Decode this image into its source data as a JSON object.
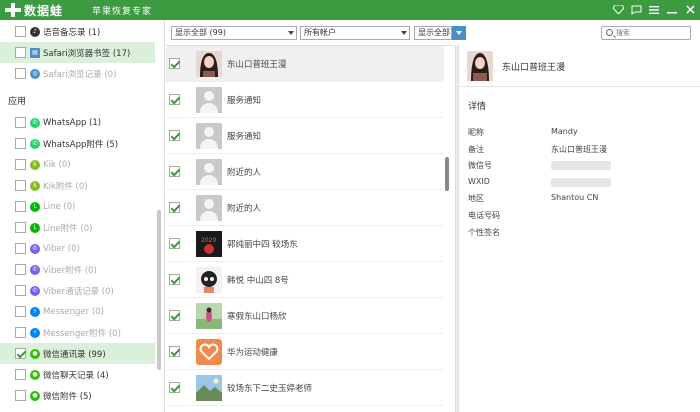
{
  "titlebar": {
    "title": "数据蛙",
    "subtitle": "苹果恢复专家",
    "icons": [
      "diamond-icon",
      "chat-icon",
      "menu-icon",
      "minimize-icon",
      "close-icon"
    ]
  },
  "sidebar": {
    "top_items": [
      {
        "label": "语音备忘录 (1)",
        "icon": "voice-memo-icon",
        "color": "#333333",
        "checked": false,
        "dim": false
      },
      {
        "label": "Safari浏览器书签 (17)",
        "icon": "book-icon",
        "color": "#4a90c8",
        "checked": false,
        "dim": false,
        "selected": true
      },
      {
        "label": "Safari浏览记录 (0)",
        "icon": "safari-icon",
        "color": "#4a90c8",
        "checked": false,
        "dim": true
      }
    ],
    "section_title": "应用",
    "app_items": [
      {
        "label": "WhatsApp (1)",
        "icon": "whatsapp-icon",
        "color": "#25d366",
        "checked": false,
        "dim": false
      },
      {
        "label": "WhatsApp附件 (5)",
        "icon": "whatsapp-icon",
        "color": "#25d366",
        "checked": false,
        "dim": false
      },
      {
        "label": "Kik (0)",
        "icon": "kik-icon",
        "color": "#82bc23",
        "checked": false,
        "dim": true
      },
      {
        "label": "Kik附件 (0)",
        "icon": "kik-icon",
        "color": "#82bc23",
        "checked": false,
        "dim": true
      },
      {
        "label": "Line (0)",
        "icon": "line-icon",
        "color": "#00b900",
        "checked": false,
        "dim": true
      },
      {
        "label": "Line附件 (0)",
        "icon": "line-icon",
        "color": "#00b900",
        "checked": false,
        "dim": true
      },
      {
        "label": "Viber (0)",
        "icon": "viber-icon",
        "color": "#7360f2",
        "checked": false,
        "dim": true
      },
      {
        "label": "Viber附件 (0)",
        "icon": "viber-icon",
        "color": "#7360f2",
        "checked": false,
        "dim": true
      },
      {
        "label": "Viber通话记录 (0)",
        "icon": "viber-icon",
        "color": "#7360f2",
        "checked": false,
        "dim": true
      },
      {
        "label": "Messenger (0)",
        "icon": "messenger-icon",
        "color": "#0084ff",
        "checked": false,
        "dim": true
      },
      {
        "label": "Messenger附件 (0)",
        "icon": "messenger-icon",
        "color": "#0084ff",
        "checked": false,
        "dim": true
      },
      {
        "label": "微信通讯录 (99)",
        "icon": "wechat-icon",
        "color": "#2dc100",
        "checked": true,
        "dim": false,
        "selected": true
      },
      {
        "label": "微信聊天记录 (4)",
        "icon": "wechat-icon",
        "color": "#2dc100",
        "checked": false,
        "dim": false
      },
      {
        "label": "微信附件 (5)",
        "icon": "wechat-icon",
        "color": "#2dc100",
        "checked": false,
        "dim": false
      }
    ]
  },
  "filter": {
    "show_all_select": "显示全部 (99)",
    "account_select": "所有帐户",
    "show_all_button": "显示全部",
    "search_placeholder": "搜索"
  },
  "contacts": [
    {
      "name": "东山口普班王漫",
      "avatar": "photo-girl",
      "checked": true,
      "selected": true
    },
    {
      "name": "服务通知",
      "avatar": "default",
      "checked": true
    },
    {
      "name": "服务通知",
      "avatar": "default",
      "checked": true
    },
    {
      "name": "附近的人",
      "avatar": "default",
      "checked": true
    },
    {
      "name": "附近的人",
      "avatar": "default",
      "checked": true
    },
    {
      "name": "郭纯丽中四 较场东",
      "avatar": "photo-2020",
      "checked": true
    },
    {
      "name": "韩悦 中山四 8号",
      "avatar": "photo-cartoon",
      "checked": true
    },
    {
      "name": "寒假东山口杨欣",
      "avatar": "photo-outdoor",
      "checked": true
    },
    {
      "name": "华为运动健康",
      "avatar": "huawei-health",
      "checked": true
    },
    {
      "name": "较场东下二史玉婷老师",
      "avatar": "photo-landscape",
      "checked": true
    }
  ],
  "detail": {
    "name": "东山口普班王漫",
    "section_title": "详情",
    "fields": [
      {
        "key": "昵称",
        "value": "Mandy"
      },
      {
        "key": "备注",
        "value": "东山口普班王漫"
      },
      {
        "key": "微信号",
        "value": "",
        "redacted": true
      },
      {
        "key": "WXID",
        "value": "",
        "redacted": true
      },
      {
        "key": "地区",
        "value": "Shantou CN"
      },
      {
        "key": "电话号码",
        "value": ""
      },
      {
        "key": "个性签名",
        "value": ""
      }
    ]
  }
}
